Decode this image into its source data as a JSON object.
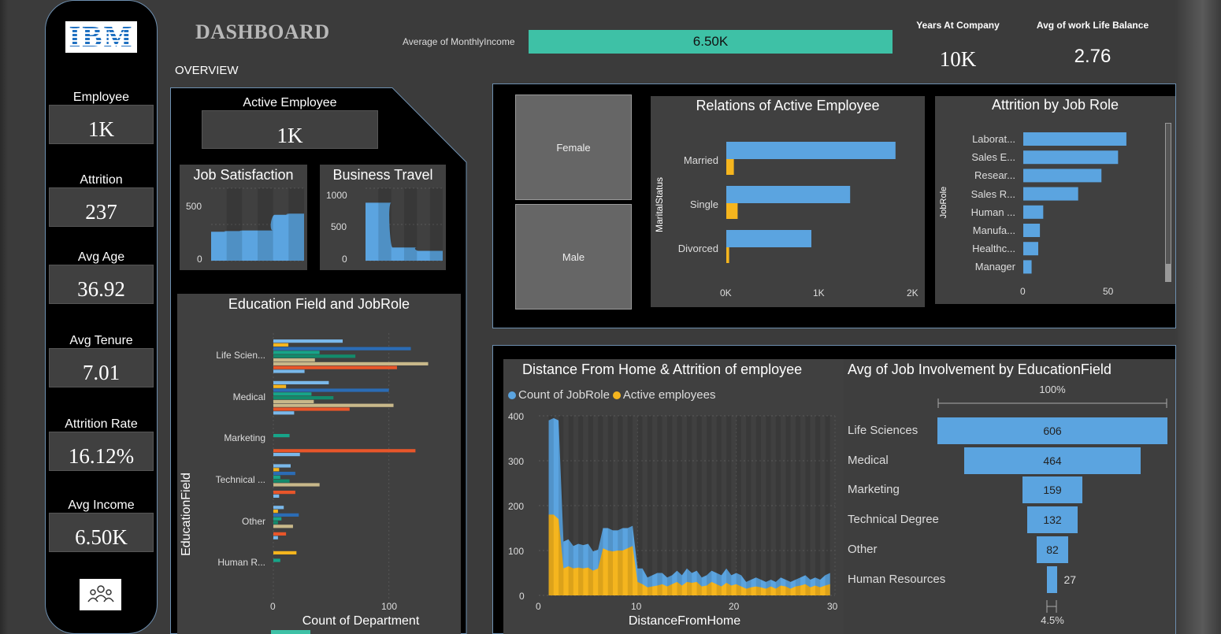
{
  "header": {
    "title": "DASHBOARD",
    "overview": "OVERVIEW",
    "avg_monthly_income_label": "Average of MonthlyIncome",
    "avg_monthly_income_value": "6.50K",
    "years_at_company_label": "Years At Company",
    "years_at_company_value": "10K",
    "work_life_label": "Avg of work Life Balance",
    "work_life_value": "2.76"
  },
  "sidebar": {
    "logo": "IBM",
    "kpis": [
      {
        "label": "Employee",
        "value": "1K"
      },
      {
        "label": "Attrition",
        "value": "237"
      },
      {
        "label": "Avg Age",
        "value": "36.92"
      },
      {
        "label": "Avg Tenure",
        "value": "7.01"
      },
      {
        "label": "Attrition Rate",
        "value": "16.12%"
      },
      {
        "label": "Avg Income",
        "value": "6.50K"
      }
    ],
    "people_icon": "people-icon"
  },
  "active_employee": {
    "label": "Active Employee",
    "value": "1K"
  },
  "gender": {
    "female": "Female",
    "male": "Male"
  },
  "colors": {
    "blue": "#5ba4e0",
    "dark_blue": "#2b6cb5",
    "teal": "#17a589",
    "yellow": "#f5b51e",
    "orange": "#e8562a",
    "tan": "#c8b88a",
    "green_accent": "#3ec1a6",
    "light_blue": "#7ab8ea",
    "dark_teal": "#138a6b",
    "light_orange": "#f08040"
  },
  "chart_data": [
    {
      "id": "job_satisfaction",
      "type": "area",
      "title": "Job Satisfaction",
      "y_ticks": [
        "500",
        "0"
      ],
      "ylim": [
        0,
        600
      ],
      "values": [
        240,
        245,
        250,
        250,
        380,
        390
      ]
    },
    {
      "id": "business_travel",
      "type": "area",
      "title": "Business Travel",
      "y_ticks": [
        "1000",
        "500",
        "0"
      ],
      "ylim": [
        0,
        1100
      ],
      "values": [
        880,
        880,
        200,
        200,
        150,
        150
      ]
    },
    {
      "id": "relations_active",
      "type": "bar",
      "orientation": "horizontal",
      "title": "Relations of Active Employee",
      "ylabel": "MaritalStatus",
      "categories": [
        "Married",
        "Single",
        "Divorced"
      ],
      "x_ticks": [
        "0K",
        "1K",
        "2K"
      ],
      "xlim": [
        0,
        2000
      ],
      "series": [
        {
          "values": [
            1790,
            1310,
            900
          ]
        },
        {
          "values": [
            80,
            120,
            30
          ]
        }
      ]
    },
    {
      "id": "attrition_job_role",
      "type": "bar",
      "orientation": "horizontal",
      "title": "Attrition by Job Role",
      "ylabel": "JobRole",
      "categories": [
        "Laborat...",
        "Sales E...",
        "Resear...",
        "Sales R...",
        "Human ...",
        "Manufa...",
        "Healthc...",
        "Manager"
      ],
      "x_ticks": [
        "0",
        "50"
      ],
      "xlim": [
        0,
        90
      ],
      "values": [
        62,
        57,
        47,
        33,
        12,
        10,
        9,
        5
      ]
    },
    {
      "id": "education_jobrole",
      "type": "bar",
      "orientation": "horizontal",
      "title": "Education Field and JobRole",
      "xlabel": "Count of Department",
      "ylabel": "EducationField",
      "categories": [
        "Life Scien...",
        "Medical",
        "Marketing",
        "Technical ...",
        "Other",
        "Human R..."
      ],
      "x_ticks": [
        "0",
        "100"
      ],
      "xlim": [
        0,
        150
      ],
      "series": [
        {
          "values": [
            60,
            48,
            0,
            15,
            9,
            0
          ]
        },
        {
          "values": [
            13,
            11,
            0,
            5,
            4,
            20
          ]
        },
        {
          "values": [
            119,
            100,
            0,
            19,
            22,
            0
          ]
        },
        {
          "values": [
            40,
            33,
            14,
            6,
            7,
            6
          ]
        },
        {
          "values": [
            71,
            52,
            0,
            14,
            4,
            0
          ]
        },
        {
          "values": [
            36,
            35,
            0,
            40,
            17,
            0
          ]
        },
        {
          "values": [
            134,
            104,
            0,
            0,
            0,
            0
          ]
        },
        {
          "values": [
            107,
            66,
            123,
            19,
            11,
            0
          ]
        },
        {
          "values": [
            27,
            18,
            23,
            5,
            4,
            0
          ]
        }
      ]
    },
    {
      "id": "distance_attrition",
      "type": "area",
      "title": "Distance From Home & Attrition of employee",
      "xlabel": "DistanceFromHome",
      "x_ticks": [
        "0",
        "10",
        "20",
        "30"
      ],
      "y_ticks": [
        "400",
        "300",
        "200",
        "100",
        "0"
      ],
      "xlim": [
        0,
        30
      ],
      "ylim": [
        0,
        400
      ],
      "legend": "top-left",
      "series": [
        {
          "name": "Count of JobRole",
          "x": [
            1,
            1.5,
            2,
            2.5,
            3,
            3.5,
            4,
            4.5,
            5,
            5.5,
            6,
            6.5,
            7,
            7.5,
            8,
            8.5,
            9,
            9.5,
            10,
            10.5,
            11,
            11.5,
            12,
            12.5,
            13,
            13.5,
            14,
            14.5,
            15,
            15.5,
            16,
            16.5,
            17,
            17.5,
            18,
            18.5,
            19,
            19.5,
            20,
            20.5,
            21,
            21.5,
            22,
            22.5,
            23,
            23.5,
            24,
            24.5,
            25,
            25.5,
            26,
            26.5,
            27,
            27.5,
            28,
            28.5,
            29,
            29.5
          ],
          "values": [
            390,
            395,
            390,
            120,
            125,
            110,
            115,
            112,
            115,
            98,
            102,
            150,
            150,
            145,
            145,
            150,
            150,
            155,
            60,
            60,
            40,
            45,
            50,
            50,
            40,
            45,
            55,
            45,
            60,
            50,
            55,
            40,
            45,
            55,
            50,
            45,
            60,
            45,
            50,
            45,
            30,
            35,
            40,
            35,
            30,
            35,
            30,
            40,
            35,
            30,
            35,
            40,
            45,
            35,
            40,
            35,
            45,
            50
          ]
        },
        {
          "name": "Active employees",
          "x": [
            1,
            1.5,
            2,
            2.5,
            3,
            3.5,
            4,
            4.5,
            5,
            5.5,
            6,
            6.5,
            7,
            7.5,
            8,
            8.5,
            9,
            9.5,
            10,
            10.5,
            11,
            11.5,
            12,
            12.5,
            13,
            13.5,
            14,
            14.5,
            15,
            15.5,
            16,
            16.5,
            17,
            17.5,
            18,
            18.5,
            19,
            19.5,
            20,
            20.5,
            21,
            21.5,
            22,
            22.5,
            23,
            23.5,
            24,
            24.5,
            25,
            25.5,
            26,
            26.5,
            27,
            27.5,
            28,
            28.5,
            29,
            29.5
          ],
          "values": [
            180,
            180,
            170,
            60,
            65,
            60,
            62,
            60,
            62,
            55,
            60,
            105,
            100,
            98,
            100,
            100,
            105,
            110,
            30,
            25,
            18,
            20,
            22,
            25,
            20,
            25,
            30,
            22,
            30,
            28,
            30,
            20,
            22,
            30,
            25,
            20,
            28,
            22,
            25,
            20,
            15,
            18,
            20,
            18,
            15,
            20,
            15,
            22,
            20,
            15,
            20,
            22,
            25,
            18,
            22,
            18,
            22,
            25
          ]
        }
      ]
    },
    {
      "id": "job_involvement_funnel",
      "type": "bar",
      "orientation": "funnel",
      "title": "Avg of Job Involvement by EducationField",
      "top_label": "100%",
      "bottom_label": "4.5%",
      "categories": [
        "Life Sciences",
        "Medical",
        "Marketing",
        "Technical Degree",
        "Other",
        "Human Resources"
      ],
      "values": [
        606,
        464,
        159,
        132,
        82,
        27
      ],
      "value_labels": [
        "606",
        "464",
        "159",
        "132",
        "82",
        "27"
      ]
    }
  ]
}
